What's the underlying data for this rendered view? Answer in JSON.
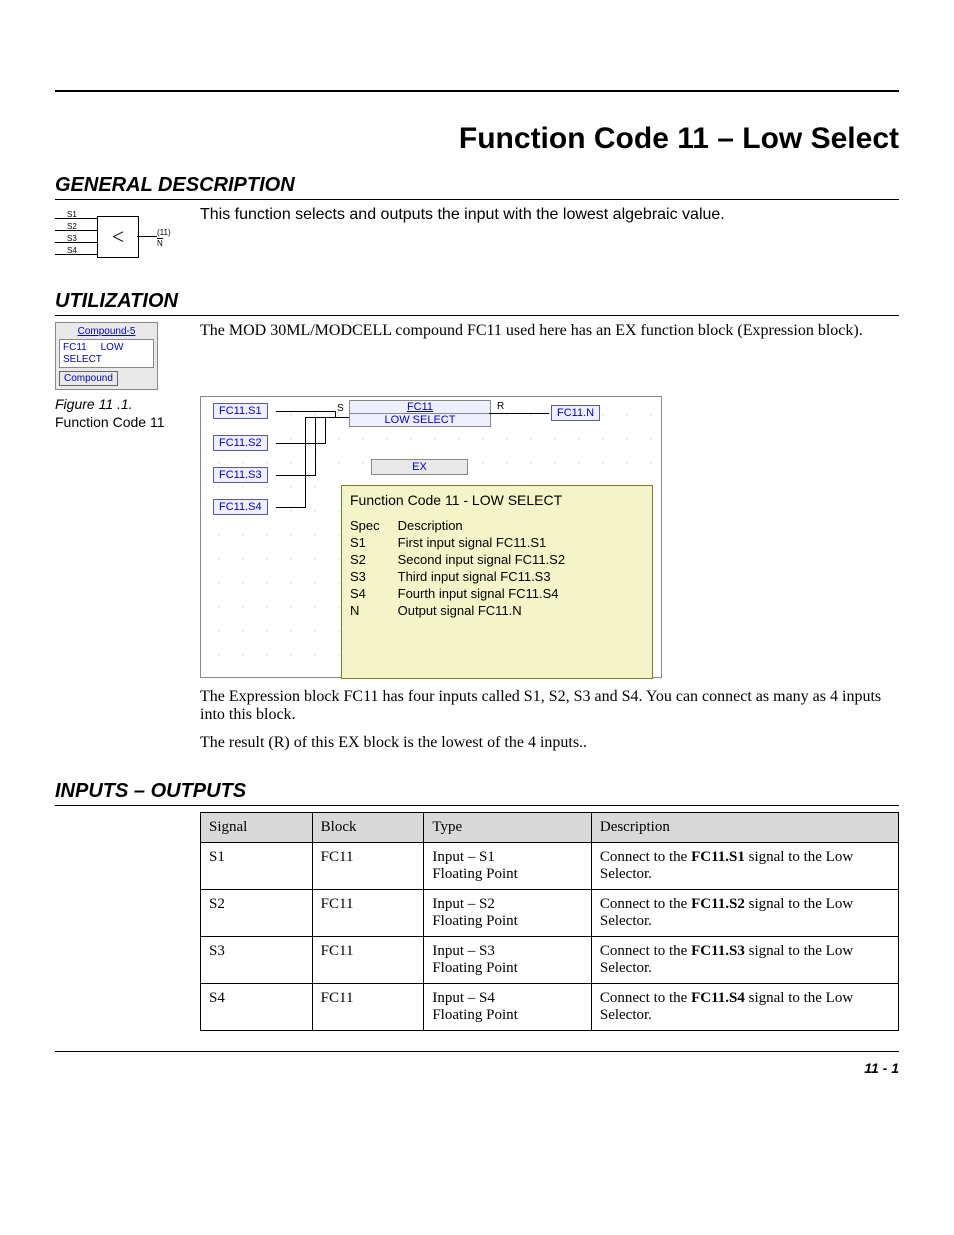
{
  "title": "Function Code 11 – Low Select",
  "page_number": "11 - 1",
  "sections": {
    "general": {
      "heading": "GENERAL DESCRIPTION",
      "text": "This function selects and outputs the input with the lowest algebraic value.",
      "icon": {
        "inputs": [
          "S1",
          "S2",
          "S3",
          "S4"
        ],
        "symbol": "<",
        "out_top": "(11)",
        "out_bottom": "N"
      }
    },
    "utilization": {
      "heading": "UTILIZATION",
      "text": "The MOD 30ML/MODCELL compound FC11 used here has an EX function block (Expression block).",
      "compound_box": {
        "title": "Compound-5",
        "line1": "FC11",
        "line2": "LOW",
        "line3": "SELECT",
        "button": "Compound"
      },
      "figure": {
        "caption_title": "Figure 11 .1.",
        "caption_sub": "Function Code 11"
      },
      "diagram": {
        "inputs": [
          "FC11.S1",
          "FC11.S2",
          "FC11.S3",
          "FC11.S4"
        ],
        "block_top": "FC11",
        "block_bottom": "LOW SELECT",
        "ex": "EX",
        "r_label": "R",
        "s_label": "S",
        "output": "FC11.N",
        "panel_title": "Function Code 11 - LOW SELECT",
        "panel_head_spec": "Spec",
        "panel_head_desc": "Description",
        "panel_rows": [
          {
            "spec": "S1",
            "desc": "First input signal FC11.S1"
          },
          {
            "spec": "S2",
            "desc": "Second input signal FC11.S2"
          },
          {
            "spec": "S3",
            "desc": "Third input signal FC11.S3"
          },
          {
            "spec": "S4",
            "desc": "Fourth input signal FC11.S4"
          },
          {
            "spec": "N",
            "desc": "Output signal FC11.N"
          }
        ]
      },
      "after_text_1": "The Expression block FC11 has four inputs called S1, S2, S3 and S4. You can connect as many as 4 inputs into this block.",
      "after_text_2": "The result (R) of this EX block is the lowest of the 4 inputs.."
    },
    "io": {
      "heading": "INPUTS – OUTPUTS",
      "headers": [
        "Signal",
        "Block",
        "Type",
        "Description"
      ],
      "rows": [
        {
          "signal": "S1",
          "block": "FC11",
          "type": "Input – S1\nFloating Point",
          "desc_pre": "Connect to the ",
          "desc_bold": "FC11.S1",
          "desc_post": " signal to the Low Selector."
        },
        {
          "signal": "S2",
          "block": "FC11",
          "type": "Input – S2\nFloating Point",
          "desc_pre": "Connect to the ",
          "desc_bold": "FC11.S2",
          "desc_post": " signal to the Low Selector."
        },
        {
          "signal": "S3",
          "block": "FC11",
          "type": "Input –  S3\nFloating Point",
          "desc_pre": "Connect to the ",
          "desc_bold": "FC11.S3",
          "desc_post": " signal to the Low Selector."
        },
        {
          "signal": "S4",
          "block": "FC11",
          "type": "Input –  S4\nFloating Point",
          "desc_pre": "Connect to the ",
          "desc_bold": "FC11.S4",
          "desc_post": " signal to the Low Selector."
        }
      ]
    }
  }
}
